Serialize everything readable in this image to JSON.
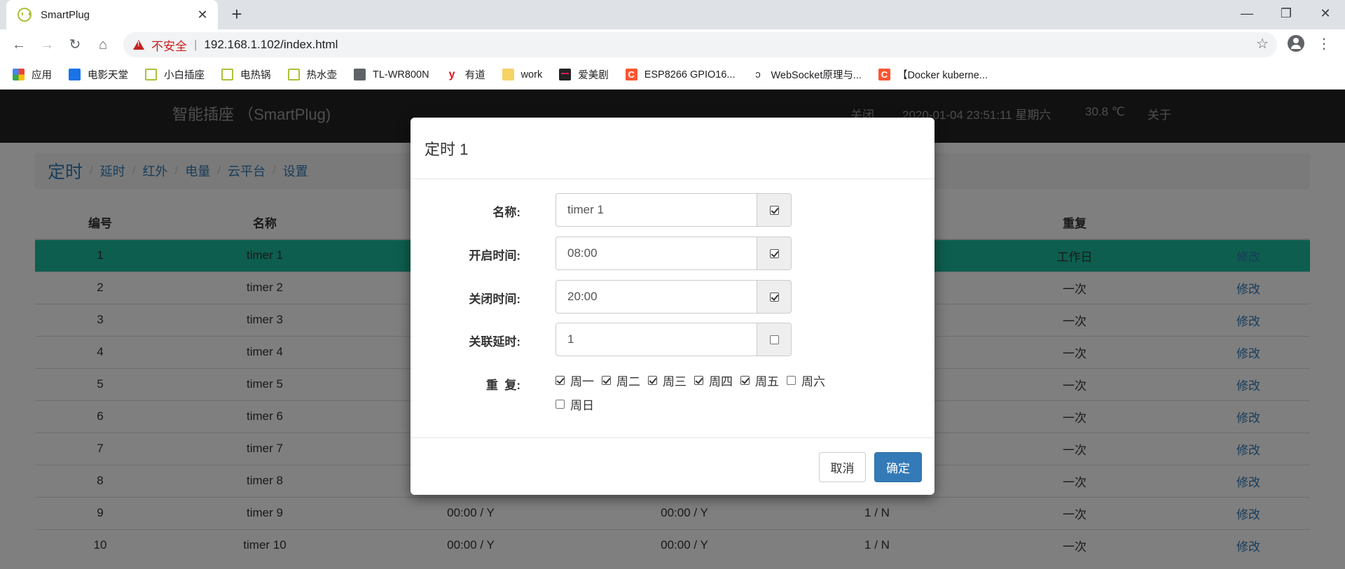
{
  "browser": {
    "tab_title": "SmartPlug",
    "tab_close": "✕",
    "new_tab": "+",
    "insecure_label": "不安全",
    "separator": "|",
    "url": "192.168.1.102/index.html",
    "bookmarks": [
      {
        "label": "应用",
        "icon": "apps-icon"
      },
      {
        "label": "电影天堂",
        "icon": "film-icon"
      },
      {
        "label": "小白插座",
        "icon": "plug-icon"
      },
      {
        "label": "电热锅",
        "icon": "plug-icon"
      },
      {
        "label": "热水壶",
        "icon": "plug-icon"
      },
      {
        "label": "TL-WR800N",
        "icon": "globe-icon"
      },
      {
        "label": "有道",
        "icon": "youdao-icon"
      },
      {
        "label": "work",
        "icon": "folder-icon"
      },
      {
        "label": "爱美剧",
        "icon": "aimei-icon"
      },
      {
        "label": "ESP8266 GPIO16...",
        "icon": "csdn-icon"
      },
      {
        "label": "WebSocket原理与...",
        "icon": "websocket-icon"
      },
      {
        "label": "【Docker kuberne...",
        "icon": "csdn-icon"
      }
    ]
  },
  "navbar": {
    "brand": "智能插座 （SmartPlug)",
    "status": "关闭",
    "datetime": "2020-01-04 23:51:11 星期六",
    "temperature": "30.8 ℃",
    "about": "关于"
  },
  "breadcrumb": {
    "active": "定时",
    "links": [
      "延时",
      "红外",
      "电量",
      "云平台",
      "设置"
    ],
    "divider": "/"
  },
  "table": {
    "headers": [
      "编号",
      "名称",
      "",
      "",
      "",
      "重复",
      ""
    ],
    "edit_label": "修改",
    "rows": [
      {
        "id": "1",
        "name": "timer 1",
        "on": "",
        "off": "",
        "delay": "",
        "repeat": "工作日"
      },
      {
        "id": "2",
        "name": "timer 2",
        "on": "",
        "off": "",
        "delay": "",
        "repeat": "一次"
      },
      {
        "id": "3",
        "name": "timer 3",
        "on": "",
        "off": "",
        "delay": "",
        "repeat": "一次"
      },
      {
        "id": "4",
        "name": "timer 4",
        "on": "",
        "off": "",
        "delay": "",
        "repeat": "一次"
      },
      {
        "id": "5",
        "name": "timer 5",
        "on": "",
        "off": "",
        "delay": "",
        "repeat": "一次"
      },
      {
        "id": "6",
        "name": "timer 6",
        "on": "",
        "off": "",
        "delay": "",
        "repeat": "一次"
      },
      {
        "id": "7",
        "name": "timer 7",
        "on": "",
        "off": "",
        "delay": "",
        "repeat": "一次"
      },
      {
        "id": "8",
        "name": "timer 8",
        "on": "",
        "off": "",
        "delay": "",
        "repeat": "一次"
      },
      {
        "id": "9",
        "name": "timer 9",
        "on": "00:00 / Y",
        "off": "00:00 / Y",
        "delay": "1 / N",
        "repeat": "一次"
      },
      {
        "id": "10",
        "name": "timer 10",
        "on": "00:00 / Y",
        "off": "00:00 / Y",
        "delay": "1 / N",
        "repeat": "一次"
      }
    ]
  },
  "modal": {
    "title": "定时 1",
    "name_label": "名称:",
    "name_value": "timer 1",
    "name_enabled": true,
    "on_label": "开启时间:",
    "on_value": "08:00",
    "on_enabled": true,
    "off_label": "关闭时间:",
    "off_value": "20:00",
    "off_enabled": true,
    "delay_label": "关联延时:",
    "delay_value": "1",
    "delay_enabled": false,
    "repeat_label": "重  复:",
    "days": [
      {
        "label": "周一",
        "checked": true
      },
      {
        "label": "周二",
        "checked": true
      },
      {
        "label": "周三",
        "checked": true
      },
      {
        "label": "周四",
        "checked": true
      },
      {
        "label": "周五",
        "checked": true
      },
      {
        "label": "周六",
        "checked": false
      },
      {
        "label": "周日",
        "checked": false
      }
    ],
    "cancel_label": "取消",
    "ok_label": "确定"
  },
  "colors": {
    "selected_row": "#1abc9c",
    "link": "#337ab7",
    "navbar_bg": "#222222",
    "primary_button": "#337ab7",
    "insecure": "#c5221f"
  }
}
